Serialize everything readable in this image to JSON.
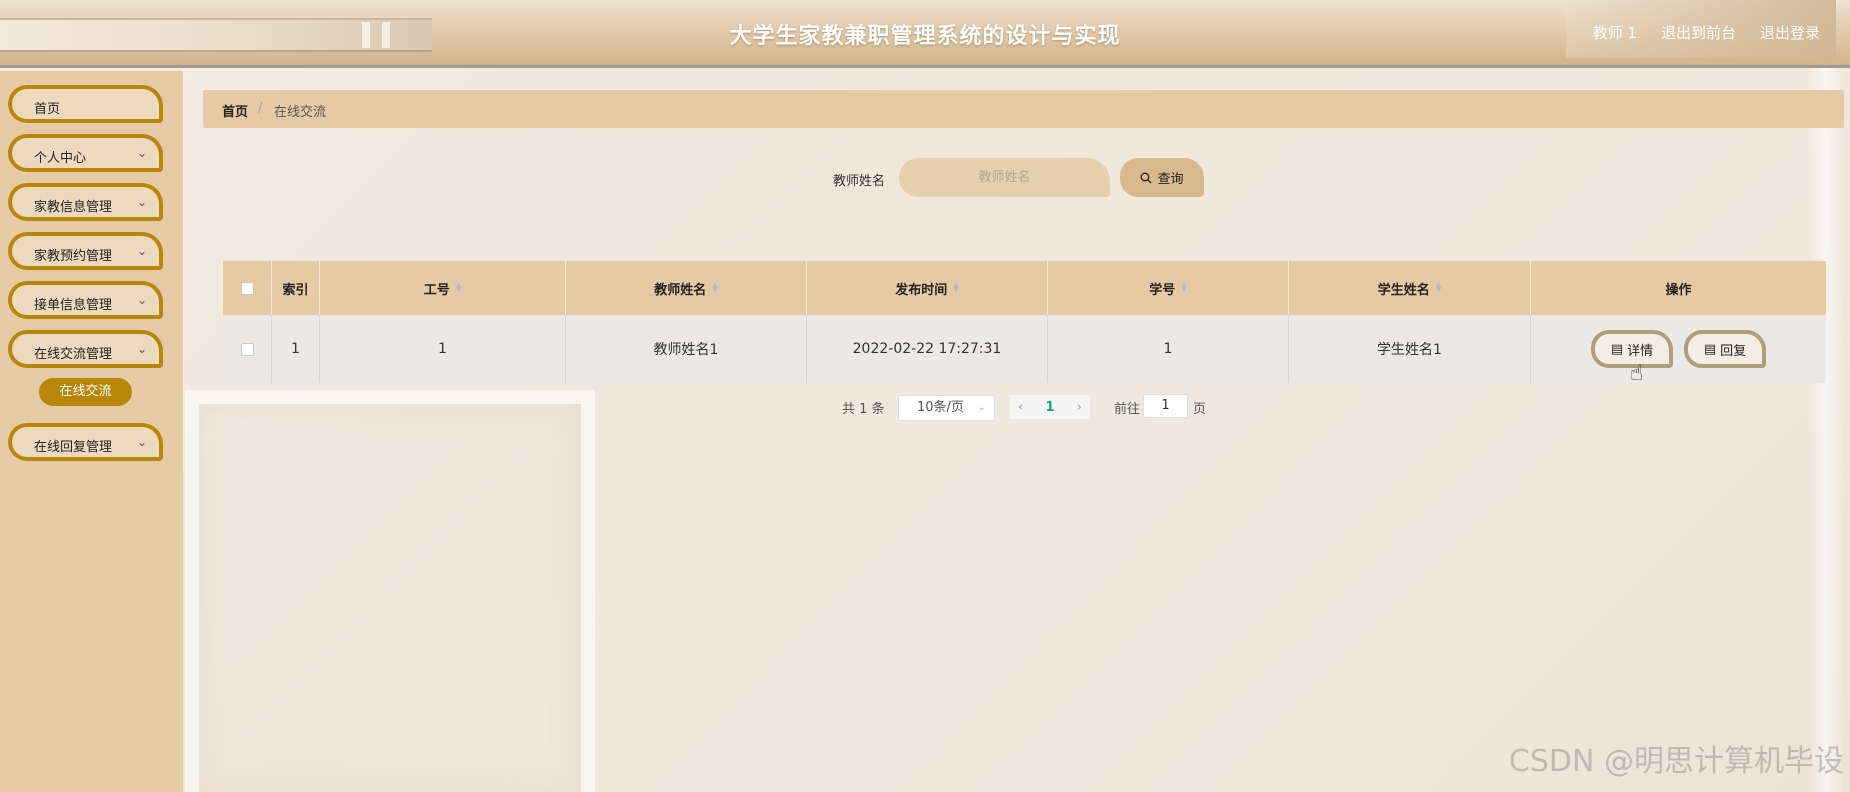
{
  "header": {
    "title": "大学生家教兼职管理系统的设计与实现",
    "user": "教师 1",
    "back_to_front": "退出到前台",
    "logout": "退出登录"
  },
  "sidebar": {
    "items": [
      {
        "label": "首页",
        "has_arrow": false
      },
      {
        "label": "个人中心",
        "has_arrow": true
      },
      {
        "label": "家教信息管理",
        "has_arrow": true
      },
      {
        "label": "家教预约管理",
        "has_arrow": true
      },
      {
        "label": "接单信息管理",
        "has_arrow": true
      },
      {
        "label": "在线交流管理",
        "has_arrow": true
      },
      {
        "label": "在线回复管理",
        "has_arrow": true
      }
    ],
    "active_sub": "在线交流"
  },
  "breadcrumb": {
    "home": "首页",
    "separator": "/",
    "current": "在线交流"
  },
  "search": {
    "label": "教师姓名",
    "placeholder": "教师姓名",
    "button": "查询"
  },
  "table": {
    "headers": [
      "索引",
      "工号",
      "教师姓名",
      "发布时间",
      "学号",
      "学生姓名",
      "操作"
    ],
    "rows": [
      {
        "index": "1",
        "job_no": "1",
        "teacher_name": "教师姓名1",
        "publish_time": "2022-02-22 17:27:31",
        "student_no": "1",
        "student_name": "学生姓名1"
      }
    ],
    "actions": {
      "detail": "详情",
      "reply": "回复"
    }
  },
  "pagination": {
    "total": "共 1 条",
    "page_size": "10条/页",
    "current": "1",
    "goto": "前往",
    "goto_value": "1",
    "page_unit": "页"
  },
  "watermark": "CSDN @明思计算机毕设",
  "colors": {
    "accent": "#b8860b",
    "panel": "#e6caa6",
    "active_page": "#1e9e8a"
  },
  "icons": {
    "search": "search-icon",
    "detail": "document-icon",
    "reply": "document-icon",
    "chevron": "chevron-down-icon"
  }
}
